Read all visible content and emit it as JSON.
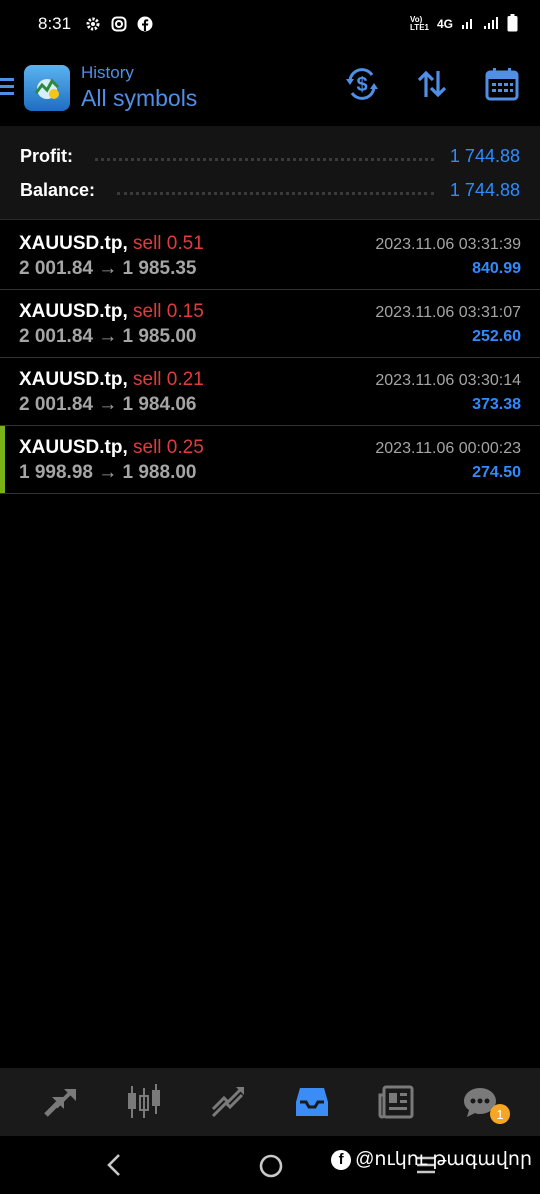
{
  "status_bar": {
    "time": "8:31",
    "icons": [
      "gear-icon",
      "instagram-icon",
      "facebook-icon"
    ],
    "right_icons": [
      "volte-icon",
      "signal-4g-icon",
      "signal-icon",
      "battery-icon"
    ],
    "network": "4G",
    "volte": "Vo))\nLTE1"
  },
  "header": {
    "subtitle": "History",
    "title": "All symbols",
    "actions": [
      "currency-filter-icon",
      "sort-icon",
      "calendar-icon"
    ]
  },
  "summary": {
    "profit_label": "Profit:",
    "profit_value": "1 744.88",
    "balance_label": "Balance:",
    "balance_value": "1 744.88"
  },
  "trades": [
    {
      "symbol": "XAUUSD.tp,",
      "side": "sell 0.51",
      "prices": "2 001.84 → 1 985.35",
      "time": "2023.11.06 03:31:39",
      "profit": "840.99",
      "highlighted": false
    },
    {
      "symbol": "XAUUSD.tp,",
      "side": "sell 0.15",
      "prices": "2 001.84 → 1 985.00",
      "time": "2023.11.06 03:31:07",
      "profit": "252.60",
      "highlighted": false
    },
    {
      "symbol": "XAUUSD.tp,",
      "side": "sell 0.21",
      "prices": "2 001.84 → 1 984.06",
      "time": "2023.11.06 03:30:14",
      "profit": "373.38",
      "highlighted": false
    },
    {
      "symbol": "XAUUSD.tp,",
      "side": "sell 0.25",
      "prices": "1 998.98 → 1 988.00",
      "time": "2023.11.06 00:00:23",
      "profit": "274.50",
      "highlighted": true
    }
  ],
  "bottom_nav": {
    "items": [
      "quotes-icon",
      "chart-icon",
      "trade-icon",
      "history-icon",
      "news-icon",
      "chat-icon"
    ],
    "active": "history-icon",
    "chat_badge": "1"
  },
  "watermark": {
    "text": "@ուկու թագավոր"
  },
  "colors": {
    "accent_blue": "#2f8bff",
    "header_blue": "#4f8fe6",
    "sell_red": "#e03c3c",
    "row_highlight": "#7ab317"
  }
}
